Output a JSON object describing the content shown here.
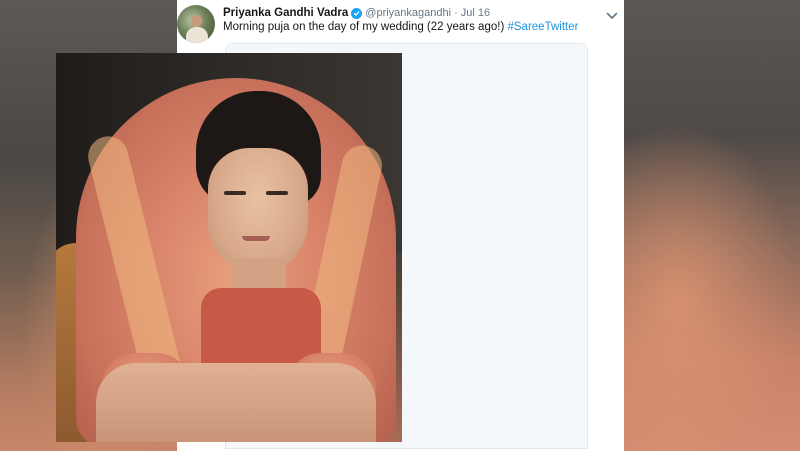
{
  "tweet": {
    "author_name": "Priyanka Gandhi Vadra",
    "handle": "@priyankagandhi",
    "separator": "·",
    "date": "Jul 16",
    "text": "Morning puja on the day of my wedding (22 years ago!)",
    "hashtag": "#SareeTwitter",
    "verified_icon": "verified-badge-icon",
    "menu_icon": "chevron-down-icon"
  },
  "colors": {
    "link": "#1b95e0",
    "verified": "#1da1f2",
    "secondary_text": "#657786",
    "primary_text": "#14171a"
  }
}
